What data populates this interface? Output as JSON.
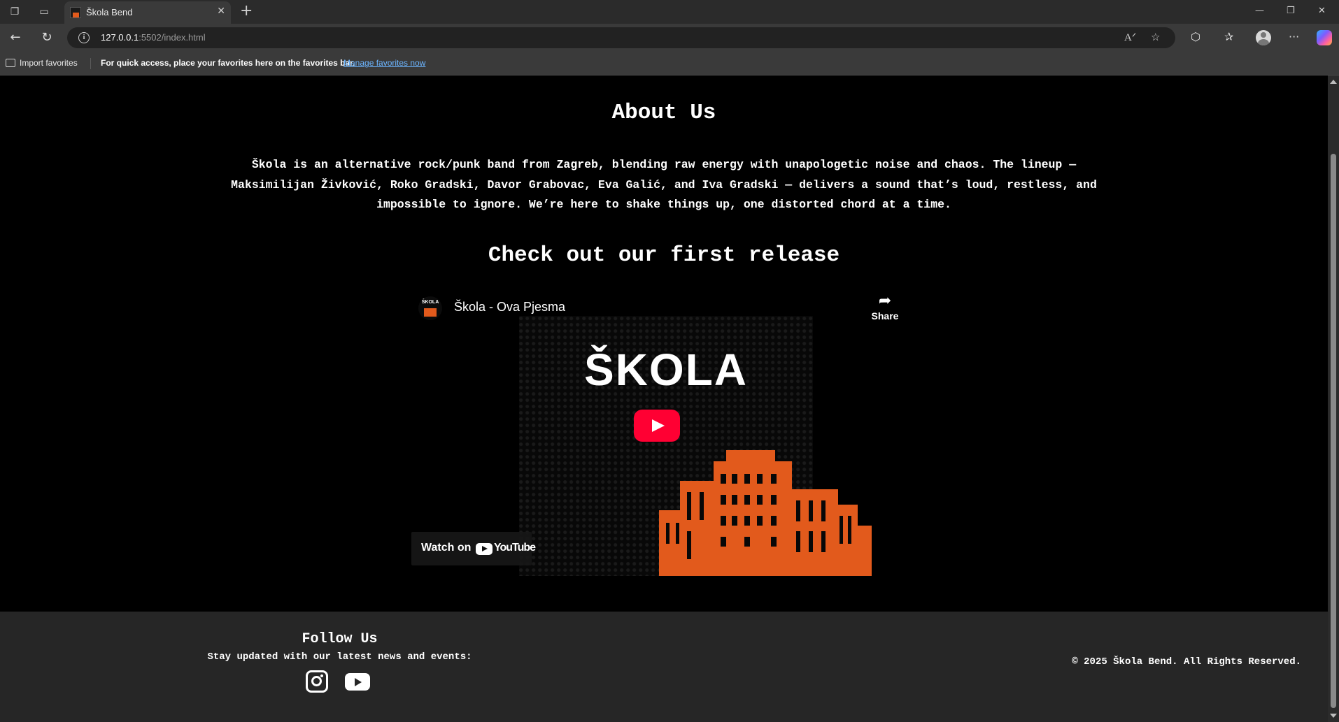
{
  "browser": {
    "tab_title": "Škola Bend",
    "url_host": "127.0.0.1",
    "url_rest": ":5502/index.html",
    "favorites_import": "Import favorites",
    "favorites_message": "For quick access, place your favorites here on the favorites bar.",
    "favorites_link": "Manage favorites now"
  },
  "about": {
    "title": "About Us",
    "text": "Škola is an alternative rock/punk band from Zagreb, blending raw energy with unapologetic noise and chaos. The lineup — Maksimilijan Živković, Roko Gradski, Davor Grabovac, Eva Galić, and Iva Gradski — delivers a sound that’s loud, restless, and impossible to ignore. We’re here to shake things up, one distorted chord at a time."
  },
  "release": {
    "title": "Check out our first release",
    "video": {
      "channel_badge": "ŠKOLA",
      "video_title": "Škola - Ova Pjesma",
      "share_label": "Share",
      "cover_title": "ŠKOLA",
      "watch_on": "Watch on",
      "youtube_wordmark": "YouTube"
    }
  },
  "footer": {
    "follow_title": "Follow Us",
    "follow_subtitle": "Stay updated with our latest news and events:",
    "social": [
      "instagram-icon",
      "youtube-icon"
    ],
    "copyright": "© 2025 Škola Bend. All Rights Reserved."
  },
  "colors": {
    "accent_orange": "#e25a1c",
    "youtube_red": "#ff0033",
    "footer_bg": "#262626"
  }
}
